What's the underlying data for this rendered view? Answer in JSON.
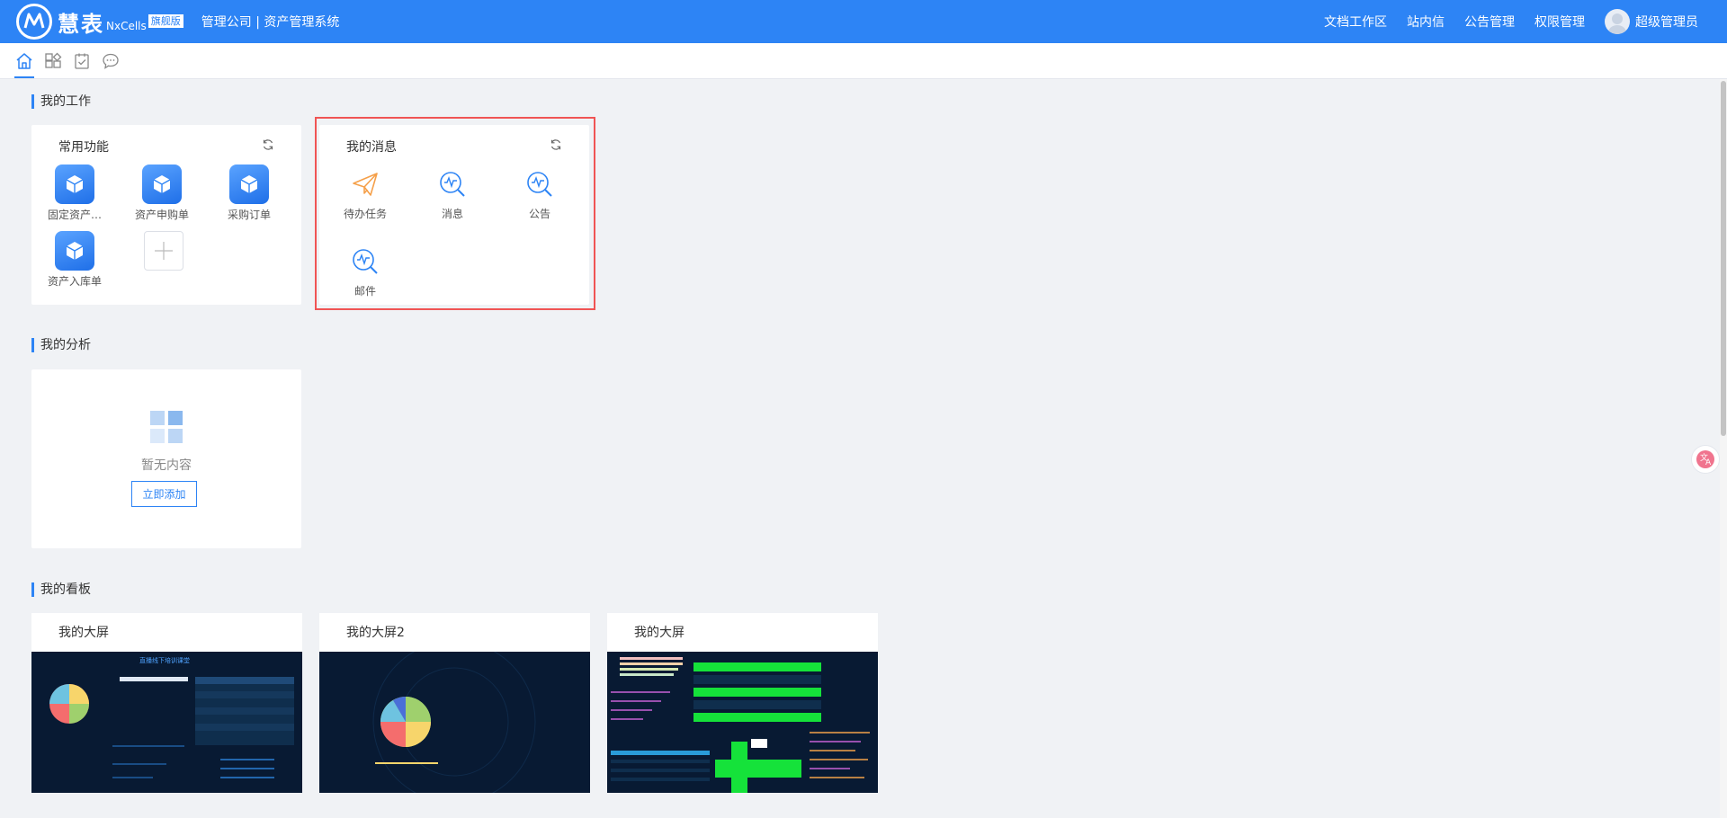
{
  "header": {
    "logo_name": "慧表",
    "logo_sub": "NxCells",
    "logo_badge": "旗舰版",
    "system_title": "管理公司 | 资产管理系统",
    "nav": [
      "文档工作区",
      "站内信",
      "公告管理",
      "权限管理"
    ],
    "user_name": "超级管理员"
  },
  "toolbar": {
    "icons": [
      "home-icon",
      "apps-icon",
      "task-icon",
      "chat-icon"
    ]
  },
  "sections": {
    "work": "我的工作",
    "analysis": "我的分析",
    "board": "我的看板"
  },
  "common_functions": {
    "title": "常用功能",
    "items": [
      "固定资产…",
      "资产申购单",
      "采购订单",
      "资产入库单"
    ]
  },
  "messages": {
    "title": "我的消息",
    "items": [
      "待办任务",
      "消息",
      "公告",
      "邮件"
    ]
  },
  "analysis": {
    "empty_text": "暂无内容",
    "add_label": "立即添加"
  },
  "boards": [
    {
      "title": "我的大屏",
      "thumb_heading": "直播线下培训课堂"
    },
    {
      "title": "我的大屏2"
    },
    {
      "title": "我的大屏"
    }
  ],
  "colors": {
    "primary": "#2d84f5",
    "highlight": "#f05454",
    "background": "#f0f2f5",
    "screen_bg": "#081a33",
    "screen_green": "#15e23a"
  }
}
